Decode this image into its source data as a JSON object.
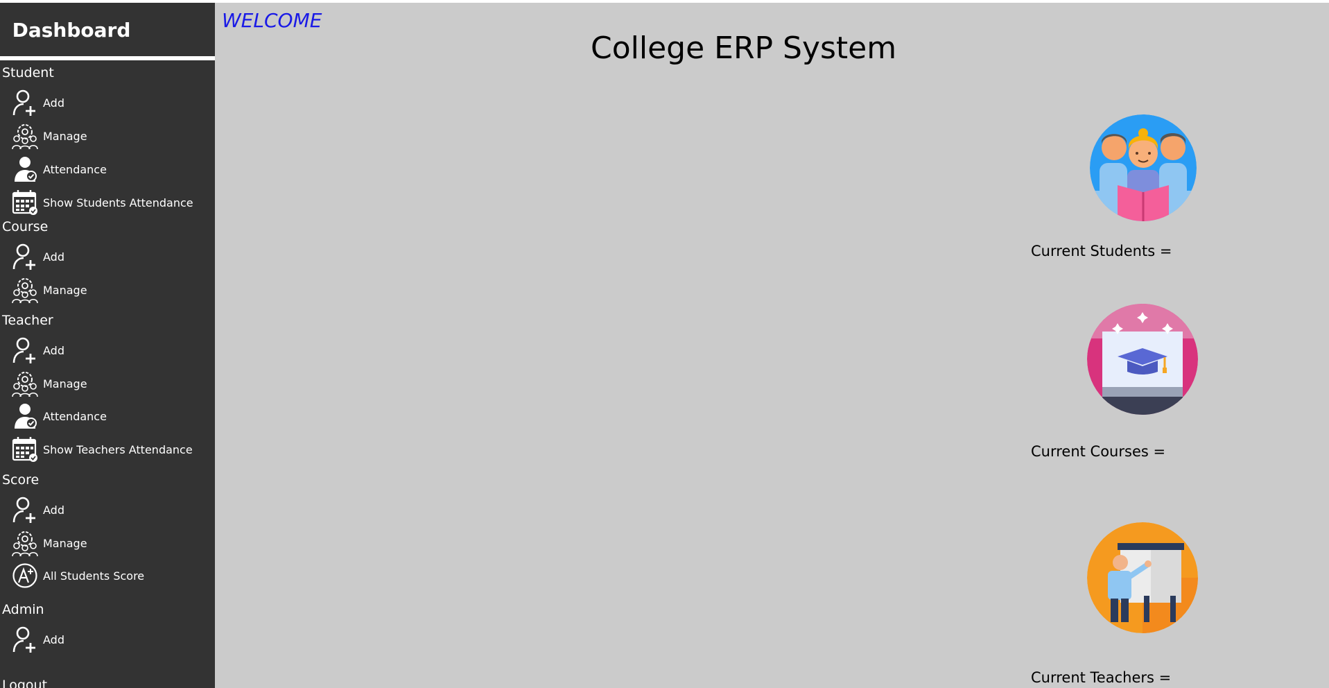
{
  "sidebar": {
    "title": "Dashboard",
    "sections": {
      "student": {
        "label": "Student",
        "add": "Add",
        "manage": "Manage",
        "attendance": "Attendance",
        "show_attendance": "Show Students Attendance"
      },
      "course": {
        "label": "Course",
        "add": "Add",
        "manage": "Manage"
      },
      "teacher": {
        "label": "Teacher",
        "add": "Add",
        "manage": "Manage",
        "attendance": "Attendance",
        "show_attendance": "Show Teachers Attendance"
      },
      "score": {
        "label": "Score",
        "add": "Add",
        "manage": "Manage",
        "all_scores": "All Students Score"
      },
      "admin": {
        "label": "Admin",
        "add": "Add"
      }
    },
    "logout": "Logout"
  },
  "main": {
    "welcome": "WELCOME",
    "title": "College ERP System",
    "stats": {
      "students": "Current Students =",
      "courses": "Current Courses =",
      "teachers": "Current Teachers ="
    }
  },
  "icons": {
    "add": "add-user-icon",
    "manage": "manage-users-gear-icon",
    "attendance": "user-check-icon",
    "show_attendance": "calendar-check-icon",
    "score": "grade-a-plus-icon"
  },
  "colors": {
    "sidebar_bg": "#333333",
    "main_bg": "#cbcbcb",
    "welcome": "#1a1ae6"
  }
}
